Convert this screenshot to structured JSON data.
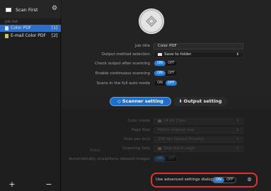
{
  "sidebar": {
    "scan_first": "Scan First",
    "job_list_label": "Job list",
    "jobs": [
      {
        "label": "Color PDF",
        "count": "[1]"
      },
      {
        "label": "E-mail Color PDF",
        "count": "[2]"
      }
    ],
    "add_symbol": "+",
    "remove_symbol": "−",
    "settings_symbol": "⚙"
  },
  "main": {
    "scan_button_icon": "diamond-icon",
    "job_title": {
      "label": "Job title",
      "value": "Color PDF"
    },
    "output_method": {
      "label": "Output method selection",
      "value": "Save to folder",
      "caret": "⬍"
    },
    "check_output": {
      "label": "Check output after scanning",
      "on": "ON",
      "off": "OFF"
    },
    "continuous": {
      "label": "Enable continuous scanning",
      "on": "ON",
      "off": "OFF"
    },
    "full_auto": {
      "label": "Scans in the full auto mode",
      "on": "ON",
      "off": "OFF"
    },
    "tabs": {
      "scanner": "Scanner setting",
      "output": "Output setting",
      "scanner_icon": "◇",
      "output_icon": "⬇"
    },
    "scanner_settings": {
      "color_mode": {
        "label": "Color mode",
        "value": "24 bit Color"
      },
      "page_size": {
        "label": "Page Size",
        "value": "Match original size"
      },
      "dpi": {
        "label": "Dots per inch",
        "value": "300 dpi (Speed Priority)"
      },
      "scanning_side": {
        "label": "Scanning Side",
        "value": "Skip blank page"
      },
      "straighten": {
        "label": "Automatically straightens skewed images",
        "on": "ON",
        "off": "OFF"
      },
      "rotate": {
        "label": "Rotat"
      },
      "advanced": {
        "label": "Use advanced settings dialog box",
        "on": "ON",
        "off": "OFF",
        "gear": "⚙"
      }
    }
  }
}
